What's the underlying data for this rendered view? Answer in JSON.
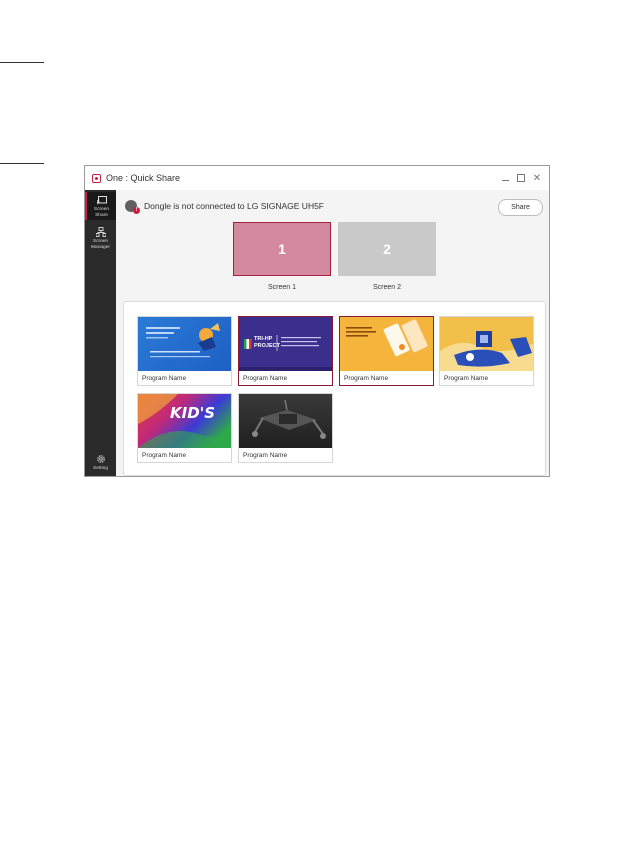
{
  "window": {
    "title": "One : Quick Share",
    "controls": [
      "minimize-icon",
      "maximize-icon",
      "close-icon"
    ],
    "close_glyph": "✕"
  },
  "sidebar": {
    "items": [
      {
        "label_line1": "Screen",
        "label_line2": "Share",
        "icon": "cast-icon",
        "active": true
      },
      {
        "label_line1": "Screen",
        "label_line2": "Manager",
        "icon": "network-icon",
        "active": false
      }
    ],
    "setting": {
      "label": "Setting",
      "icon": "gear-icon"
    }
  },
  "status": {
    "text": "Dongle is not connected to LG SIGNAGE UH5F",
    "badge": "!",
    "icon": "dongle-icon"
  },
  "share_button": {
    "label": "Share"
  },
  "screens": [
    {
      "number": "1",
      "label": "Screen 1",
      "selected": true
    },
    {
      "number": "2",
      "label": "Screen 2",
      "selected": false
    }
  ],
  "programs": [
    {
      "name": "Program Name",
      "selected": false
    },
    {
      "name": "Program Name",
      "selected": true,
      "thumb_text": "TRI-HP PROJECT"
    },
    {
      "name": "Program Name",
      "selected": true
    },
    {
      "name": "Program Name",
      "selected": false
    },
    {
      "name": "Program Name",
      "selected": false,
      "thumb_text": "KID'S"
    },
    {
      "name": "Program Name",
      "selected": false
    }
  ],
  "colors": {
    "accent": "#c8203c",
    "selected_border": "#8a1a35",
    "sidebar_bg": "#2a2a2a",
    "screen1_fill": "#d5899f",
    "screen2_fill": "#c9c9c9"
  }
}
